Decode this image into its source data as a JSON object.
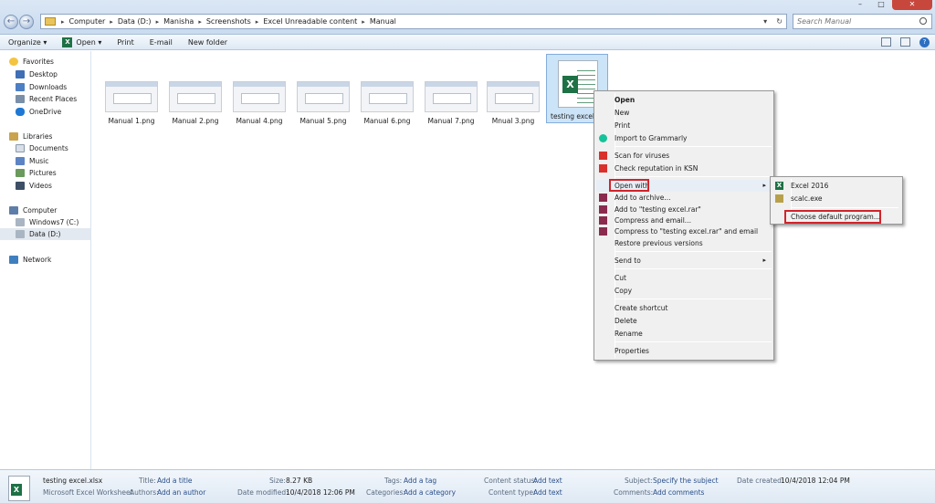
{
  "window": {
    "minimize": "–",
    "maximize": "□",
    "close": "✕"
  },
  "address": {
    "breadcrumbs": [
      "Computer",
      "Data (D:)",
      "Manisha",
      "Screenshots",
      "Excel Unreadable content",
      "Manual"
    ],
    "separator": "▸",
    "dropdown": "▾",
    "refresh": "↻"
  },
  "search": {
    "placeholder": "Search Manual"
  },
  "toolbar": {
    "organize": "Organize ▾",
    "open": "Open ▾",
    "print": "Print",
    "email": "E-mail",
    "new_folder": "New folder",
    "xl_glyph": "X",
    "help": "?"
  },
  "nav": {
    "favorites": "Favorites",
    "desktop": "Desktop",
    "downloads": "Downloads",
    "recent_places": "Recent Places",
    "onedrive": "OneDrive",
    "libraries": "Libraries",
    "documents": "Documents",
    "music": "Music",
    "pictures": "Pictures",
    "videos": "Videos",
    "computer": "Computer",
    "windows7": "Windows7 (C:)",
    "data_d": "Data (D:)",
    "network": "Network"
  },
  "files": [
    {
      "name": "Manual 1.png"
    },
    {
      "name": "Manual 2.png"
    },
    {
      "name": "Manual 4.png"
    },
    {
      "name": "Manual 5.png"
    },
    {
      "name": "Manual 6.png"
    },
    {
      "name": "Manual 7.png"
    },
    {
      "name": "Mnual 3.png"
    }
  ],
  "selected_file": {
    "name": "testing excel.x",
    "badge": "X"
  },
  "context_menu": {
    "open": "Open",
    "new": "New",
    "print": "Print",
    "grammarly": "Import to Grammarly",
    "scan": "Scan for viruses",
    "ksn": "Check reputation in KSN",
    "open_with": "Open with",
    "add_archive": "Add to archive...",
    "add_rar": "Add to \"testing excel.rar\"",
    "compress_email": "Compress and email...",
    "compress_rar_email": "Compress to \"testing excel.rar\" and email",
    "restore": "Restore previous versions",
    "send_to": "Send to",
    "cut": "Cut",
    "copy": "Copy",
    "create_shortcut": "Create shortcut",
    "delete": "Delete",
    "rename": "Rename",
    "properties": "Properties",
    "arrow": "▸"
  },
  "submenu": {
    "excel": "Excel 2016",
    "scalc": "scalc.exe",
    "choose_default": "Choose default program...",
    "xl_glyph": "X"
  },
  "details": {
    "filename": "testing excel.xlsx",
    "filetype": "Microsoft Excel Worksheet",
    "badge": "X",
    "title_key": "Title:",
    "title_val": "Add a title",
    "authors_key": "Authors:",
    "authors_val": "Add an author",
    "size_key": "Size:",
    "size_val": "8.27 KB",
    "modified_key": "Date modified:",
    "modified_val": "10/4/2018 12:06 PM",
    "tags_key": "Tags:",
    "tags_val": "Add a tag",
    "categories_key": "Categories:",
    "categories_val": "Add a category",
    "content_status_key": "Content status:",
    "content_status_val": "Add text",
    "content_type_key": "Content type:",
    "content_type_val": "Add text",
    "subject_key": "Subject:",
    "subject_val": "Specify the subject",
    "comments_key": "Comments:",
    "comments_val": "Add comments",
    "created_key": "Date created:",
    "created_val": "10/4/2018 12:04 PM"
  },
  "colors": {
    "excel_green": "#1e7145",
    "highlight_red": "#d1242b",
    "selection_blue": "#cce4f7"
  }
}
